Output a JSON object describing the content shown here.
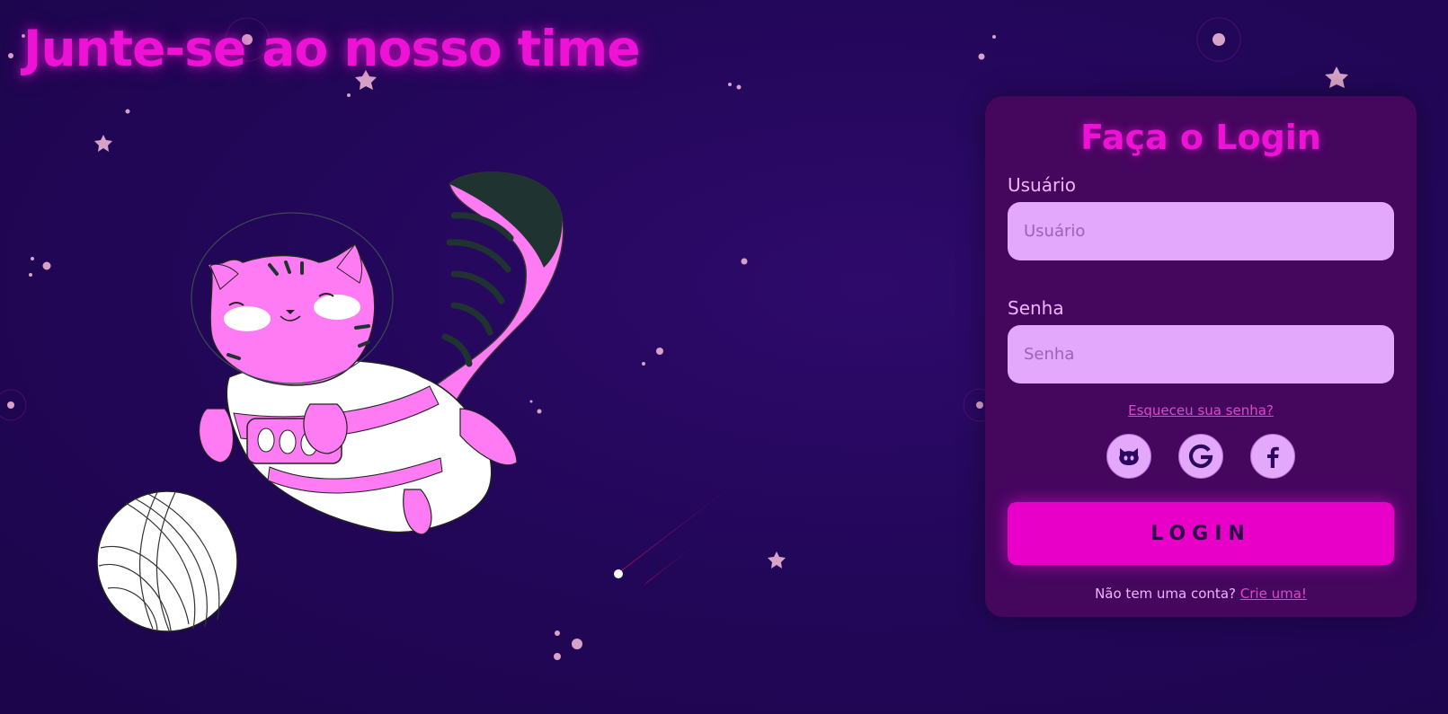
{
  "page": {
    "headline": "Junte-se ao nosso time"
  },
  "login": {
    "title": "Faça o Login",
    "username_label": "Usuário",
    "username_placeholder": "Usuário",
    "username_value": "",
    "password_label": "Senha",
    "password_placeholder": "Senha",
    "password_value": "",
    "forgot_link": "Esqueceu sua senha?",
    "social_buttons": [
      {
        "icon": "github-icon"
      },
      {
        "icon": "google-icon"
      },
      {
        "icon": "facebook-icon"
      }
    ],
    "submit_label": "LOGIN",
    "signup_prompt": "Não tem uma conta?",
    "signup_link": "Crie uma!"
  },
  "colors": {
    "background": "#23075a",
    "accent": "#ee12d6",
    "card": "#45065e",
    "input": "#e3a7fb",
    "label": "#f0b4ff",
    "button": "#e800c8"
  }
}
